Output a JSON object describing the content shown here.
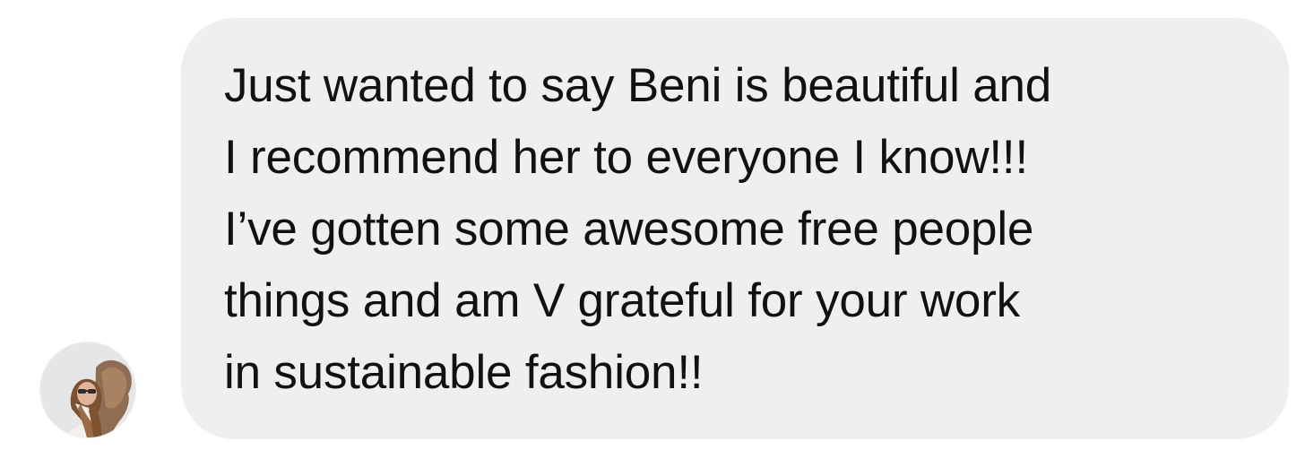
{
  "conversation": {
    "message": {
      "lines": [
        "Just wanted to say Beni is beautiful and",
        "I recommend her to everyone I know!!!",
        "I’ve gotten some awesome free people",
        "things and am V grateful for your work",
        "in sustainable fashion!!"
      ]
    },
    "sender": {
      "avatar_icon": "user-avatar-photo"
    },
    "colors": {
      "bubble_background": "#efefef",
      "text": "#111111"
    }
  }
}
